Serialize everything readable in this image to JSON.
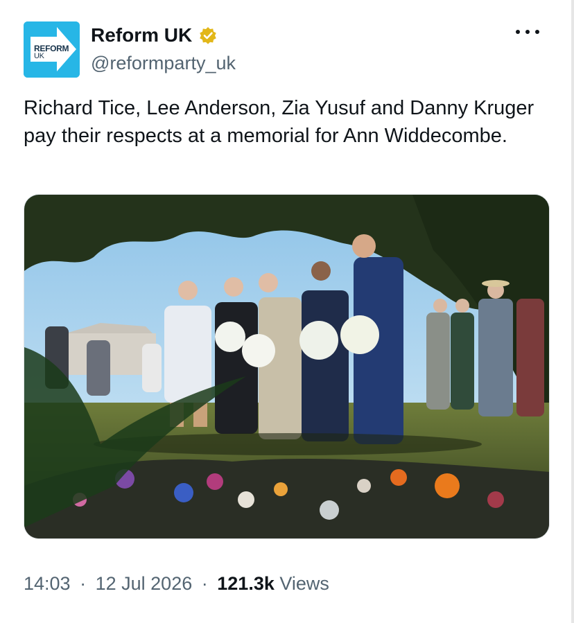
{
  "author": {
    "display_name": "Reform UK",
    "handle": "@reformparty_uk",
    "avatar_brand": "REFORM",
    "avatar_brand_sub": "UK",
    "verified_icon": "verified-badge-gold-icon"
  },
  "more_icon": "more-options-icon",
  "tweet": {
    "text": "Richard Tice, Lee Anderson, Zia Yusuf and Danny Kruger pay their respects at a memorial for Ann Widdecombe."
  },
  "meta": {
    "time": "14:03",
    "separator": "·",
    "date": "12 Jul 2026",
    "views_count": "121.3k",
    "views_label": "Views"
  },
  "colors": {
    "avatar_bg": "#27b6e6",
    "verified": "#e2b719",
    "secondary_text": "#536471"
  }
}
